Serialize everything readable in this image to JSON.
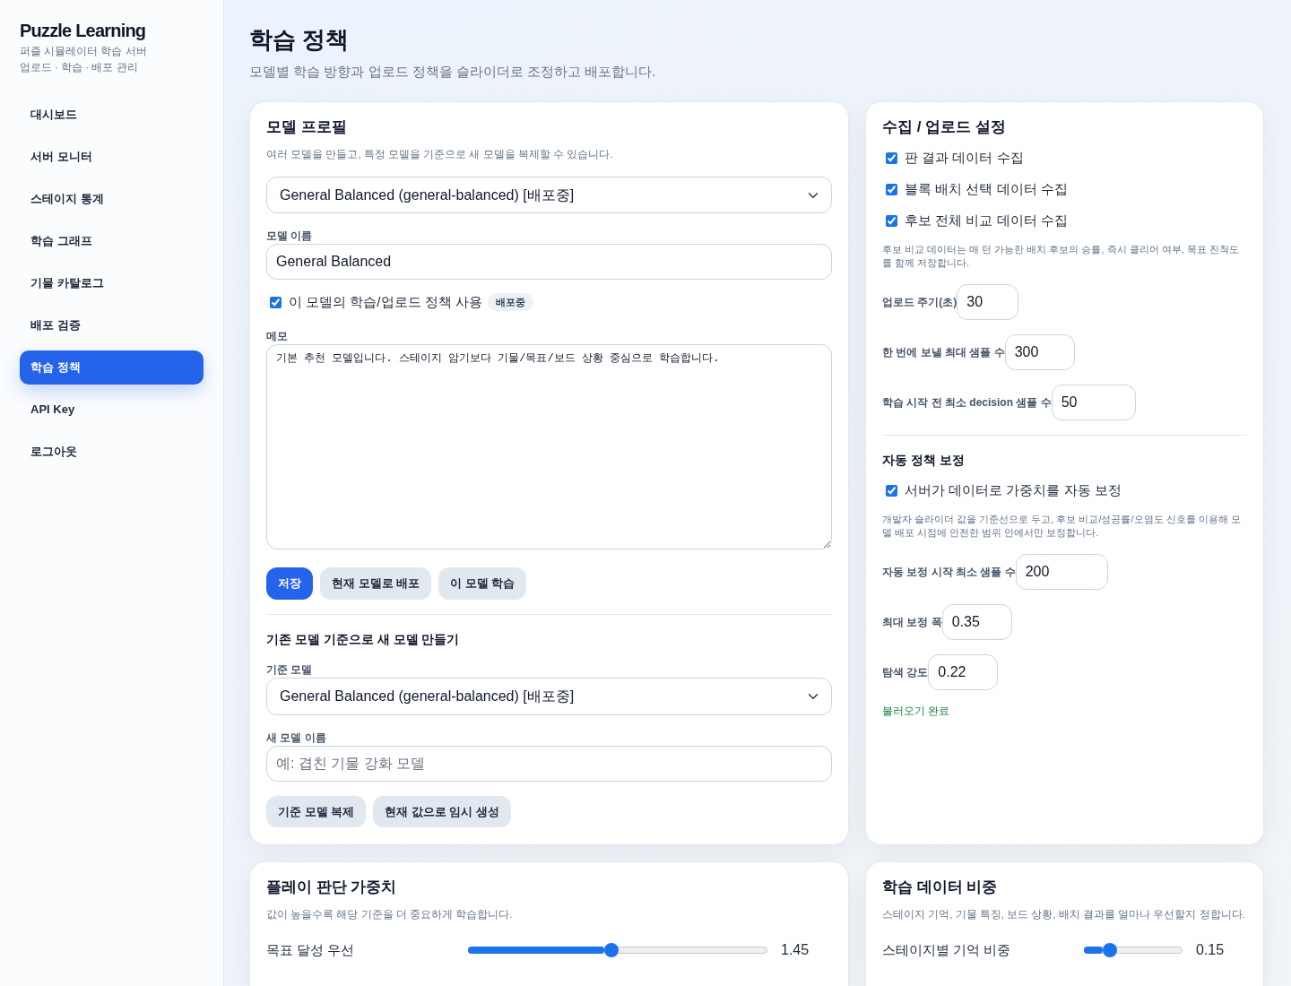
{
  "sidebar": {
    "brand": "Puzzle Learning",
    "subtitle_lines": [
      "퍼즐 시뮬레이터 학습 서버",
      "업로드 · 학습 · 배포 관리"
    ],
    "items": [
      {
        "label": "대시보드",
        "selected": false
      },
      {
        "label": "서버 모니터",
        "selected": false
      },
      {
        "label": "스테이지 통계",
        "selected": false
      },
      {
        "label": "학습 그래프",
        "selected": false
      },
      {
        "label": "기물 카탈로그",
        "selected": false
      },
      {
        "label": "배포 검증",
        "selected": false
      },
      {
        "label": "학습 정책",
        "selected": true
      },
      {
        "label": "API Key",
        "selected": false
      },
      {
        "label": "로그아웃",
        "selected": false
      }
    ]
  },
  "page": {
    "title": "학습 정책",
    "subtitle": "모델별 학습 방향과 업로드 정책을 슬라이더로 조정하고 배포합니다."
  },
  "model_profile": {
    "title": "모델 프로필",
    "description": "여러 모델을 만들고, 특정 모델을 기준으로 새 모델을 복제할 수 있습니다.",
    "model_select": "General Balanced (general-balanced) [배포중]",
    "name_label": "모델 이름",
    "name_value": "General Balanced",
    "use_policy": {
      "label": "이 모델의 학습/업로드 정책 사용",
      "checked": true,
      "badge": "배포중"
    },
    "memo_label": "메모",
    "memo_value": "기본 추천 모델입니다. 스테이지 암기보다 기물/목표/보드 상황 중심으로 학습합니다.",
    "buttons": [
      {
        "label": "저장",
        "kind": "primary"
      },
      {
        "label": "현재 모델로 배포",
        "kind": "secondary"
      },
      {
        "label": "이 모델 학습",
        "kind": "secondary"
      }
    ],
    "clone_section": {
      "title": "기존 모델 기준으로 새 모델 만들기",
      "base_label": "기준 모델",
      "base_select": "General Balanced (general-balanced) [배포중]",
      "new_name_label": "새 모델 이름",
      "new_name_placeholder": "예: 겹친 기물 강화 모델",
      "buttons": [
        {
          "label": "기준 모델 복제",
          "kind": "secondary"
        },
        {
          "label": "현재 값으로 임시 생성",
          "kind": "secondary"
        }
      ]
    }
  },
  "upload_settings": {
    "title": "수집 / 업로드 설정",
    "checkboxes": [
      {
        "label": "판 결과 데이터 수집",
        "checked": true
      },
      {
        "label": "블록 배치 선택 데이터 수집",
        "checked": true
      },
      {
        "label": "후보 전체 비교 데이터 수집",
        "checked": true
      }
    ],
    "hint": "후보 비교 데이터는 매 턴 가능한 배치 후보의 승률, 즉시 클리어 여부, 목표 진척도를 함께 저장합니다.",
    "fields": [
      {
        "label": "업로드 주기(초)",
        "value": "30"
      },
      {
        "label": "한 번에 보낼 최대 샘플 수",
        "value": "300"
      },
      {
        "label": "학습 시작 전 최소 decision 샘플 수",
        "value": "50"
      }
    ],
    "auto_tuning": {
      "title": "자동 정책 보정",
      "checkbox": {
        "label": "서버가 데이터로 가중치를 자동 보정",
        "checked": true
      },
      "hint": "개발자 슬라이더 값을 기준선으로 두고, 후보 비교/성공률/오염도 신호를 이용해 모델 배포 시점에 안전한 범위 안에서만 보정합니다.",
      "fields": [
        {
          "label": "자동 보정 시작 최소 샘플 수",
          "value": "200"
        },
        {
          "label": "최대 보정 폭",
          "value": "0.35"
        },
        {
          "label": "탐색 강도",
          "value": "0.22"
        }
      ],
      "status_message": "불러오기 완료"
    }
  },
  "play_weights": {
    "title": "플레이 판단 가중치",
    "description": "값이 높을수록 해당 기준을 더 중요하게 학습합니다.",
    "sliders": [
      {
        "label": "목표 달성 우선",
        "level": 0.48,
        "reading": "1.45"
      }
    ]
  },
  "data_weights": {
    "title": "학습 데이터 비중",
    "description": "스테이지 기억, 기물 특징, 보드 상황, 배치 결과를 얼마나 우선할지 정합니다.",
    "sliders": [
      {
        "label": "스테이지별 기억 비중",
        "level": 0.23,
        "reading": "0.15"
      }
    ]
  }
}
